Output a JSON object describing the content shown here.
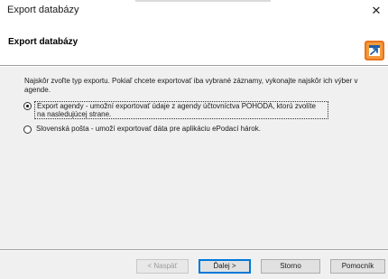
{
  "window": {
    "title": "Export databázy",
    "close_glyph": "✕"
  },
  "header": {
    "title": "Export databázy",
    "icon": "export-wizard-icon"
  },
  "instruction": "Najskôr zvoľte typ exportu. Pokiaľ chcete exportovať iba vybrané záznamy, vykonajte najskôr ich výber v agende.",
  "options": [
    {
      "label": "Export agendy - umožní exportovať údaje z agendy účtovníctva POHODA, ktorú zvolíte na nasledujúcej strane.",
      "selected": true
    },
    {
      "label": "Slovenská pošta - umoží exportovať dáta pre aplikáciu ePodací hárok.",
      "selected": false
    }
  ],
  "buttons": {
    "back": "< Naspäť",
    "next": "Ďalej >",
    "cancel": "Storno",
    "help": "Pomocník"
  },
  "colors": {
    "accent": "#0078d7",
    "icon_orange": "#e8741c"
  }
}
